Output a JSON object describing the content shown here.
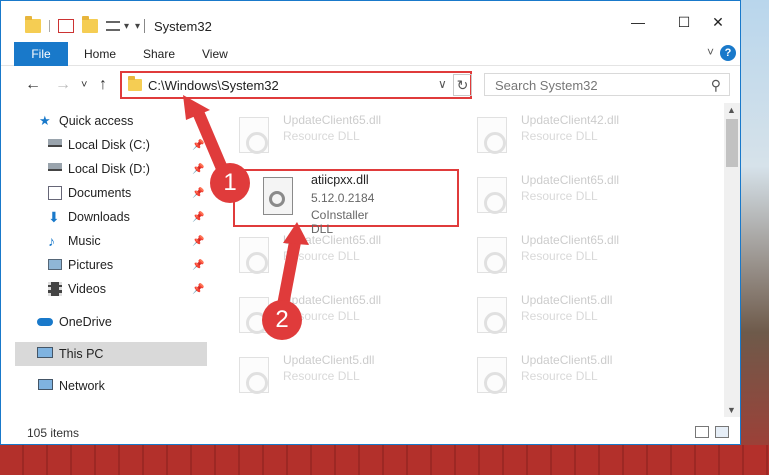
{
  "window": {
    "title": "System32",
    "controls": {
      "minimize": "—",
      "maximize": "☐",
      "close": "✕"
    }
  },
  "ribbon": {
    "file_tab": "File",
    "tabs": [
      "Home",
      "Share",
      "View"
    ]
  },
  "navigation": {
    "back": "←",
    "forward": "→",
    "recent": "˅",
    "up": "↑",
    "address_path": "C:\\Windows\\System32",
    "address_dropdown": "∨",
    "refresh": "↻",
    "search_placeholder": "Search System32",
    "search_icon": "search-icon"
  },
  "sidebar": {
    "items": [
      {
        "label": "Quick access",
        "icon": "star-icon",
        "pinned": false
      },
      {
        "label": "Local Disk (C:)",
        "icon": "drive-icon",
        "pinned": true
      },
      {
        "label": "Local Disk (D:)",
        "icon": "drive-icon",
        "pinned": true
      },
      {
        "label": "Documents",
        "icon": "documents-icon",
        "pinned": true
      },
      {
        "label": "Downloads",
        "icon": "download-icon",
        "pinned": true
      },
      {
        "label": "Music",
        "icon": "music-icon",
        "pinned": true
      },
      {
        "label": "Pictures",
        "icon": "pictures-icon",
        "pinned": true
      },
      {
        "label": "Videos",
        "icon": "videos-icon",
        "pinned": true
      },
      {
        "label": "OneDrive",
        "icon": "cloud-icon",
        "pinned": false
      },
      {
        "label": "This PC",
        "icon": "computer-icon",
        "pinned": false,
        "selected": true
      },
      {
        "label": "Network",
        "icon": "network-icon",
        "pinned": false
      }
    ],
    "pin_glyph": "📌"
  },
  "files": {
    "faded": [
      {
        "name": "UpdateClient65.dll",
        "type": "Resource DLL"
      },
      {
        "name": "UpdateClient42.dll",
        "type": "Resource DLL"
      },
      {
        "name": "UpdateClient65.dll",
        "type": "Resource DLL"
      },
      {
        "name": "UpdateClient65.dll",
        "type": "Resource DLL"
      },
      {
        "name": "UpdateClient65.dll",
        "type": "Resource DLL"
      },
      {
        "name": "UpdateClient5.dll",
        "type": "Resource DLL"
      },
      {
        "name": "UpdateClient5.dll",
        "type": "Resource DLL"
      },
      {
        "name": "UpdateClient5.dll",
        "type": "Resource DLL"
      },
      {
        "name": "UpdateClient65.dll",
        "type": "Resource DLL"
      }
    ],
    "highlighted": {
      "name": "atiicpxx.dll",
      "version": "5.12.0.2184",
      "description": "CoInstaller DLL"
    }
  },
  "annotations": {
    "badge_1": "1",
    "badge_2": "2",
    "color": "#e03b3b"
  },
  "status": {
    "item_count": "105 items"
  },
  "colors": {
    "accent": "#1979ca",
    "highlight": "#e03b3b",
    "selected_nav": "#d9d9d9"
  }
}
